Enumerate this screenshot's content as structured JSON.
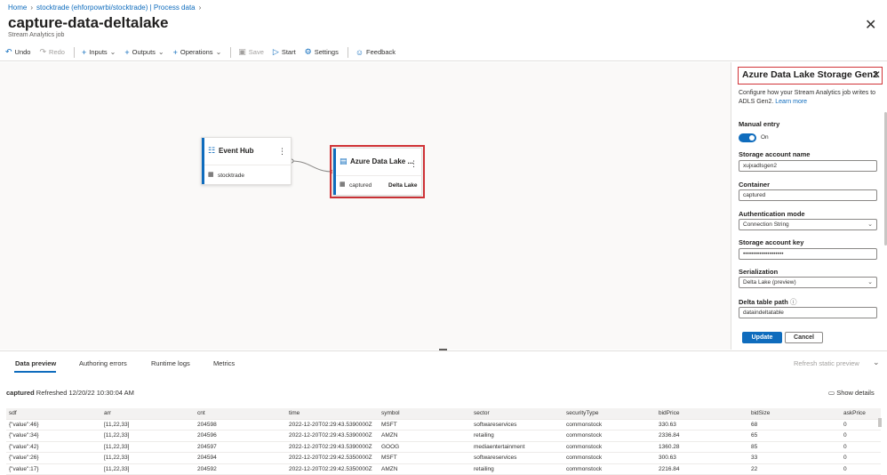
{
  "breadcrumb": [
    "Home",
    "stocktrade (ehforpowrbi/stocktrade) | Process data"
  ],
  "title": "capture-data-deltalake",
  "subtitle": "Stream Analytics job",
  "toolbar": {
    "undo": "Undo",
    "redo": "Redo",
    "inputs": "Inputs",
    "outputs": "Outputs",
    "operations": "Operations",
    "save": "Save",
    "start": "Start",
    "settings": "Settings",
    "feedback": "Feedback"
  },
  "nodes": {
    "event_hub": {
      "title": "Event Hub",
      "sub": "stocktrade"
    },
    "adls": {
      "title": "Azure Data Lake ...",
      "sub": "captured",
      "format": "Delta Lake"
    }
  },
  "panel": {
    "title": "Azure Data Lake Storage Gen2",
    "desc": "Configure how your Stream Analytics job writes to ADLS Gen2.",
    "learn_more": "Learn more",
    "manual_entry_label": "Manual entry",
    "manual_entry_state": "On",
    "storage_account_label": "Storage account name",
    "storage_account_value": "xujxadlsgen2",
    "container_label": "Container",
    "container_value": "captured",
    "auth_mode_label": "Authentication mode",
    "auth_mode_value": "Connection String",
    "key_label": "Storage account key",
    "key_value": "••••••••••••••••••••",
    "serialization_label": "Serialization",
    "serialization_value": "Delta Lake (preview)",
    "delta_path_label": "Delta table path",
    "delta_path_value": "dataindeltatable",
    "update": "Update",
    "cancel": "Cancel"
  },
  "bottom": {
    "tabs": [
      "Data preview",
      "Authoring errors",
      "Runtime logs",
      "Metrics"
    ],
    "refresh": "Refresh static preview",
    "captured": "captured",
    "refreshed": "Refreshed 12/20/22 10:30:04 AM",
    "show_details": "Show details"
  },
  "table": {
    "columns": [
      "sdf",
      "arr",
      "cnt",
      "time",
      "symbol",
      "sector",
      "securityType",
      "bidPrice",
      "bidSize",
      "askPrice"
    ],
    "rows": [
      [
        "{\"value\":46}",
        "[11,22,33]",
        "204598",
        "2022-12-20T02:29:43.5390000Z",
        "MSFT",
        "softwareservices",
        "commonstock",
        "330.63",
        "68",
        "0"
      ],
      [
        "{\"value\":34}",
        "[11,22,33]",
        "204596",
        "2022-12-20T02:29:43.5390000Z",
        "AMZN",
        "retailing",
        "commonstock",
        "2336.84",
        "65",
        "0"
      ],
      [
        "{\"value\":42}",
        "[11,22,33]",
        "204597",
        "2022-12-20T02:29:43.5390000Z",
        "GOOG",
        "mediaentertainment",
        "commonstock",
        "1360.28",
        "85",
        "0"
      ],
      [
        "{\"value\":26}",
        "[11,22,33]",
        "204594",
        "2022-12-20T02:29:42.5350000Z",
        "MSFT",
        "softwareservices",
        "commonstock",
        "300.63",
        "33",
        "0"
      ],
      [
        "{\"value\":17}",
        "[11,22,33]",
        "204592",
        "2022-12-20T02:29:42.5350000Z",
        "AMZN",
        "retailing",
        "commonstock",
        "2216.84",
        "22",
        "0"
      ]
    ]
  },
  "colors": {
    "accent": "#0f6cbd",
    "highlight": "#d13438"
  }
}
